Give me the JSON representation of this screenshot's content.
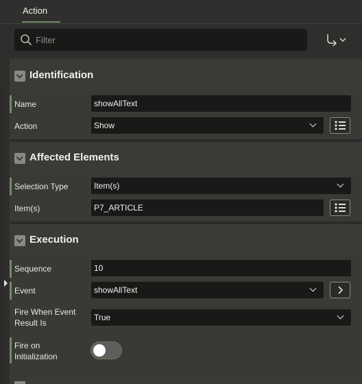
{
  "header": {
    "tab_label": "Action"
  },
  "filter": {
    "placeholder": "Filter"
  },
  "sections": {
    "identification": {
      "title": "Identification",
      "name_label": "Name",
      "name_value": "showAllText",
      "action_label": "Action",
      "action_value": "Show"
    },
    "affected": {
      "title": "Affected Elements",
      "selection_type_label": "Selection Type",
      "selection_type_value": "Item(s)",
      "items_label": "Item(s)",
      "items_value": "P7_ARTICLE"
    },
    "execution": {
      "title": "Execution",
      "sequence_label": "Sequence",
      "sequence_value": "10",
      "event_label": "Event",
      "event_value": "showAllText",
      "fire_when_label_1": "Fire When Event",
      "fire_when_label_2": "Result Is",
      "fire_when_value": "True",
      "fire_on_init_label_1": "Fire on",
      "fire_on_init_label_2": "Initialization",
      "fire_on_init_on": false
    }
  },
  "colors": {
    "accent": "#6e8f66",
    "field_bg": "#1a1918",
    "panel_bg": "#3a3936"
  }
}
